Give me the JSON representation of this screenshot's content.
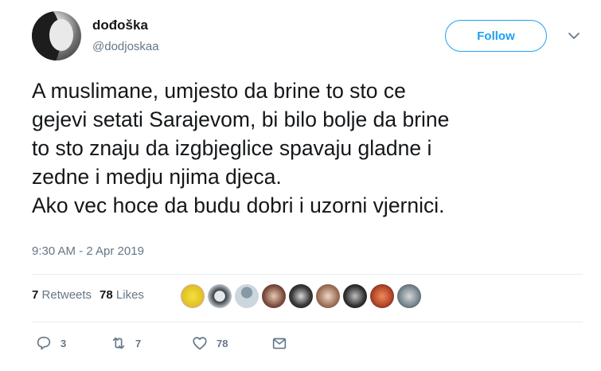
{
  "user": {
    "display_name": "dođoška",
    "handle": "@dodjoskaa"
  },
  "follow_button": {
    "label": "Follow"
  },
  "tweet": {
    "text": "A muslimane, umjesto da brine to sto ce\ngejevi setati Sarajevom, bi bilo bolje da brine\nto sto znaju da izgbjeglice spavaju gladne i\nzedne i medju njima djeca.\nAko vec hoce da budu dobri i uzorni vjernici.",
    "timestamp": "9:30 AM - 2 Apr 2019"
  },
  "stats": {
    "retweets_count": "7",
    "retweets_label": "Retweets",
    "likes_count": "78",
    "likes_label": "Likes"
  },
  "actions": {
    "reply_count": "3",
    "retweet_count": "7",
    "like_count": "78"
  },
  "colors": {
    "accent": "#1da1f2",
    "secondary_text": "#657786",
    "divider": "#e6ecf0"
  },
  "icons": {
    "reply": "reply-icon",
    "retweet": "retweet-icon",
    "like": "heart-icon",
    "message": "envelope-icon",
    "menu": "chevron-down-icon"
  }
}
